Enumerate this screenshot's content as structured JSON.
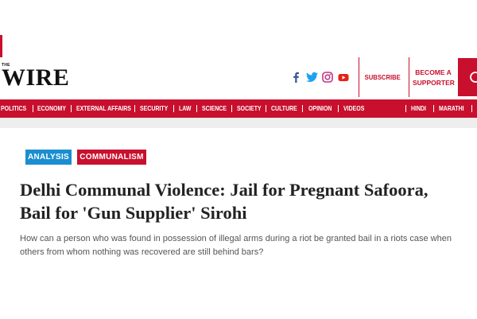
{
  "brand": {
    "the": "THE",
    "name": "WIRE"
  },
  "social": [
    "facebook-icon",
    "twitter-icon",
    "instagram-icon",
    "youtube-icon"
  ],
  "header": {
    "subscribe": "SUBSCRIBE",
    "become_line1": "BECOME A",
    "become_line2": "SUPPORTER"
  },
  "nav": {
    "items": [
      "POLITICS",
      "ECONOMY",
      "EXTERNAL AFFAIRS",
      "SECURITY",
      "LAW",
      "SCIENCE",
      "SOCIETY",
      "CULTURE",
      "OPINION",
      "VIDEOS"
    ],
    "languages": [
      "HINDI",
      "MARATHI"
    ]
  },
  "article": {
    "tags": [
      "ANALYSIS",
      "COMMUNALISM"
    ],
    "title_line1": "Delhi Communal Violence: Jail for Pregnant Safoora,",
    "title_line2": "Bail for 'Gun Supplier' Sirohi",
    "summary": "How can a person who was found in possession of illegal arms during a riot be granted bail in a riots case when others from whom nothing was recovered are still behind bars?"
  },
  "colors": {
    "brand_red": "#c8102e",
    "analysis_blue": "#1a8ed1"
  }
}
